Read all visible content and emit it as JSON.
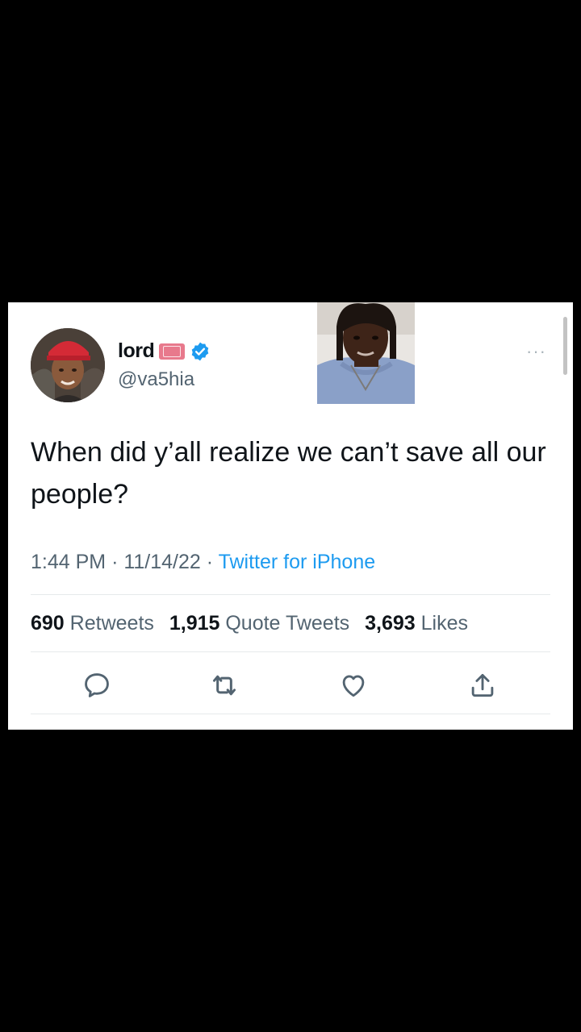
{
  "tweet": {
    "display_name": "lord",
    "handle": "@va5hia",
    "text": "When did y’all realize we can’t save all our people?",
    "time": "1:44 PM",
    "date": "11/14/22",
    "source": "Twitter for iPhone",
    "stats": {
      "retweets_count": "690",
      "retweets_label": "Retweets",
      "quotes_count": "1,915",
      "quotes_label": "Quote Tweets",
      "likes_count": "3,693",
      "likes_label": "Likes"
    },
    "more_label": "···"
  },
  "icons": {
    "reply": "reply-icon",
    "retweet": "retweet-icon",
    "like": "heart-icon",
    "share": "share-icon",
    "verified": "verified-badge-icon",
    "ticket": "ticket-emoji-icon"
  },
  "colors": {
    "background": "#000000",
    "card": "#ffffff",
    "accent": "#1d9bf0",
    "text": "#0f1419",
    "muted": "#536471"
  }
}
